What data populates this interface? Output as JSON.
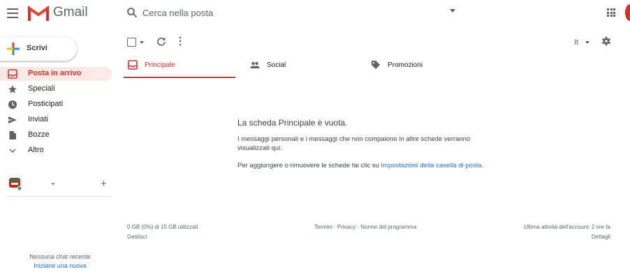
{
  "header": {
    "app_name": "Gmail",
    "search_placeholder": "Cerca nella posta",
    "brand_red": "#d93025"
  },
  "compose": {
    "label": "Scrivi"
  },
  "sidebar": {
    "items": [
      {
        "label": "Posta in arrivo",
        "icon": "inbox-icon",
        "active": true
      },
      {
        "label": "Speciali",
        "icon": "star-icon"
      },
      {
        "label": "Posticipati",
        "icon": "clock-icon"
      },
      {
        "label": "Inviati",
        "icon": "send-icon"
      },
      {
        "label": "Bozze",
        "icon": "draft-icon"
      },
      {
        "label": "Altro",
        "icon": "chevron-down-icon"
      }
    ],
    "chat": {
      "no_recent": "Nessuna chat recente",
      "start_new": "Iniziane una nuova"
    }
  },
  "toolbar": {
    "language": "It"
  },
  "tabs": [
    {
      "label": "Principale",
      "icon": "inbox-tab-icon",
      "active": true
    },
    {
      "label": "Social",
      "icon": "people-icon"
    },
    {
      "label": "Promozioni",
      "icon": "tag-icon"
    }
  ],
  "empty_state": {
    "title": "La scheda Principale è vuota.",
    "line1": "I messaggi personali e i messaggi che non compaiono in altre schede verranno visualizzati qui.",
    "line2_prefix": "Per aggiungere o rimuovere le schede fai clic su ",
    "line2_link": "Impostazioni della casella di posta",
    "line2_suffix": "."
  },
  "footer": {
    "storage": "0 GB (0%) di 15 GB utilizzati",
    "manage": "Gestisci",
    "terms": "Termini",
    "privacy": "Privacy",
    "policies": "Norme del programma",
    "separator": " · ",
    "last_activity": "Ultima attività dell'account: 2 ore fa",
    "details": "Dettagli"
  }
}
